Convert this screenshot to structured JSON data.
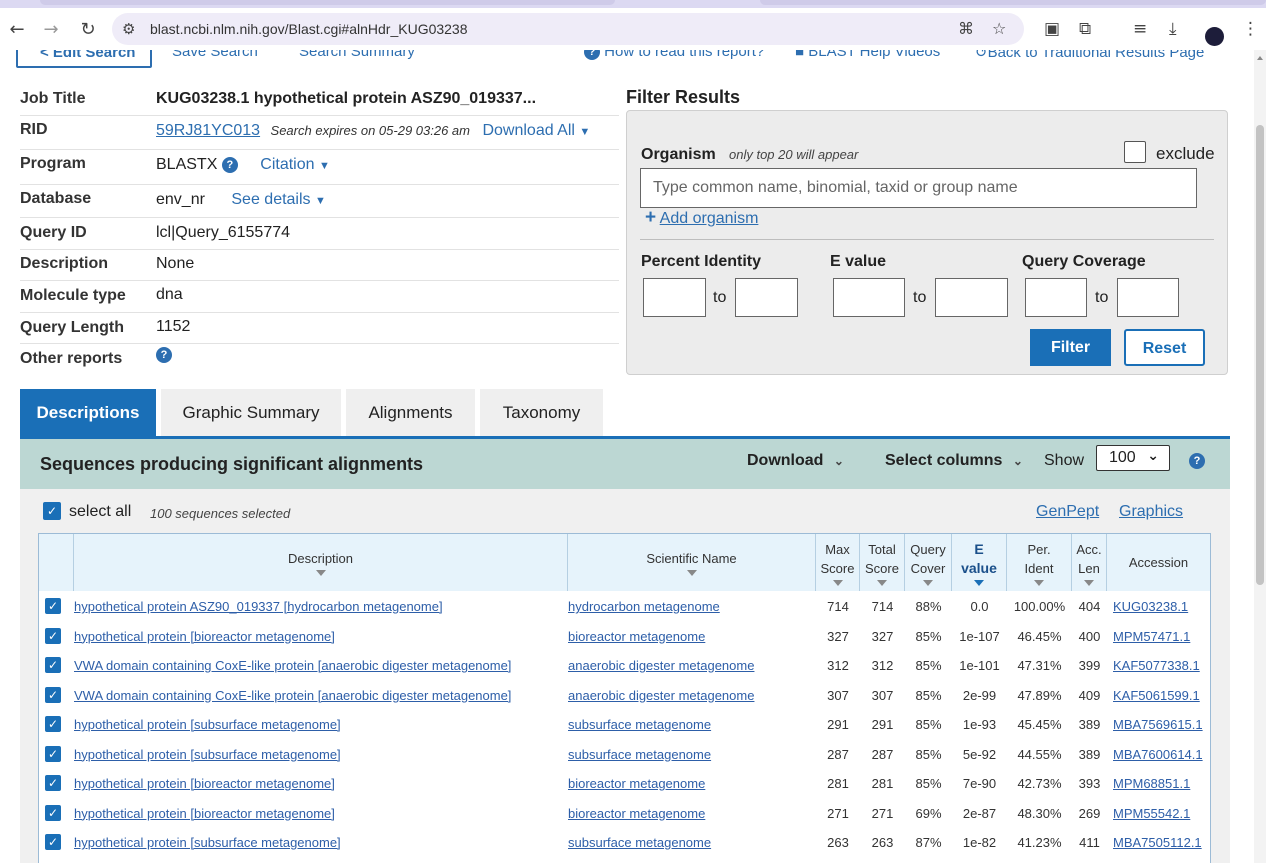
{
  "browser": {
    "url": "blast.ncbi.nlm.nih.gov/Blast.cgi#alnHdr_KUG03238",
    "icons": [
      "back-icon",
      "forward-icon",
      "reload-icon",
      "site-info-icon",
      "translate-icon",
      "bookmark-star-icon",
      "extension-icon",
      "puzzle-icon",
      "media-icon",
      "download-icon",
      "profile-avatar",
      "menu-icon"
    ]
  },
  "top_links": {
    "edit_search": "< Edit Search",
    "save_search": "Save Search",
    "search_summary": "Search Summary",
    "how_to_read": "How to read this report?",
    "help_videos": "BLAST Help Videos",
    "back_traditional": "Back to Traditional Results Page"
  },
  "job": {
    "rows": [
      {
        "label": "Job Title",
        "value": "KUG03238.1 hypothetical protein ASZ90_019337..."
      },
      {
        "label": "RID",
        "value": "59RJ81YC013",
        "note": "Search expires on 05-29 03:26 am",
        "action": "Download All"
      },
      {
        "label": "Program",
        "value": "BLASTX",
        "action": "Citation"
      },
      {
        "label": "Database",
        "value": "env_nr",
        "action": "See details"
      },
      {
        "label": "Query ID",
        "value": "lcl|Query_6155774"
      },
      {
        "label": "Description",
        "value": "None"
      },
      {
        "label": "Molecule type",
        "value": "dna"
      },
      {
        "label": "Query Length",
        "value": "1152"
      },
      {
        "label": "Other reports",
        "value": ""
      }
    ]
  },
  "filter": {
    "title": "Filter Results",
    "organism_label": "Organism",
    "organism_note": "only top 20 will appear",
    "exclude_label": "exclude",
    "organism_placeholder": "Type common  name, binomial, taxid or group  name",
    "add_organism": "Add organism",
    "percent_identity": "Percent Identity",
    "e_value": "E value",
    "query_coverage": "Query Coverage",
    "to": "to",
    "filter_button": "Filter",
    "reset_button": "Reset"
  },
  "tabs": [
    "Descriptions",
    "Graphic Summary",
    "Alignments",
    "Taxonomy"
  ],
  "results": {
    "title": "Sequences producing significant alignments",
    "download": "Download",
    "select_columns": "Select columns",
    "show_label": "Show",
    "show_value": "100",
    "select_all": "select all",
    "selected_count": "100 sequences selected",
    "genpept": "GenPept",
    "graphics": "Graphics"
  },
  "table": {
    "headers": {
      "description": "Description",
      "scientific_name": "Scientific Name",
      "max_score": [
        "Max",
        "Score"
      ],
      "total_score": [
        "Total",
        "Score"
      ],
      "query_cover": [
        "Query",
        "Cover"
      ],
      "e_value": [
        "E",
        "value"
      ],
      "per_ident": [
        "Per.",
        "Ident"
      ],
      "acc_len": [
        "Acc.",
        "Len"
      ],
      "accession": "Accession"
    },
    "rows": [
      {
        "description": "hypothetical protein ASZ90_019337 [hydrocarbon metagenome]",
        "scientific_name": "hydrocarbon metagenome",
        "max_score": "714",
        "total_score": "714",
        "query_cover": "88%",
        "e_value": "0.0",
        "per_ident": "100.00%",
        "acc_len": "404",
        "accession": "KUG03238.1"
      },
      {
        "description": "hypothetical protein [bioreactor metagenome]",
        "scientific_name": "bioreactor metagenome",
        "max_score": "327",
        "total_score": "327",
        "query_cover": "85%",
        "e_value": "1e-107",
        "per_ident": "46.45%",
        "acc_len": "400",
        "accession": "MPM57471.1"
      },
      {
        "description": "VWA domain containing CoxE-like protein [anaerobic digester metagenome]",
        "scientific_name": "anaerobic digester metagenome",
        "max_score": "312",
        "total_score": "312",
        "query_cover": "85%",
        "e_value": "1e-101",
        "per_ident": "47.31%",
        "acc_len": "399",
        "accession": "KAF5077338.1"
      },
      {
        "description": "VWA domain containing CoxE-like protein [anaerobic digester metagenome]",
        "scientific_name": "anaerobic digester metagenome",
        "max_score": "307",
        "total_score": "307",
        "query_cover": "85%",
        "e_value": "2e-99",
        "per_ident": "47.89%",
        "acc_len": "409",
        "accession": "KAF5061599.1"
      },
      {
        "description": "hypothetical protein [subsurface metagenome]",
        "scientific_name": "subsurface metagenome",
        "max_score": "291",
        "total_score": "291",
        "query_cover": "85%",
        "e_value": "1e-93",
        "per_ident": "45.45%",
        "acc_len": "389",
        "accession": "MBA7569615.1"
      },
      {
        "description": "hypothetical protein [subsurface metagenome]",
        "scientific_name": "subsurface metagenome",
        "max_score": "287",
        "total_score": "287",
        "query_cover": "85%",
        "e_value": "5e-92",
        "per_ident": "44.55%",
        "acc_len": "389",
        "accession": "MBA7600614.1"
      },
      {
        "description": "hypothetical protein [bioreactor metagenome]",
        "scientific_name": "bioreactor metagenome",
        "max_score": "281",
        "total_score": "281",
        "query_cover": "85%",
        "e_value": "7e-90",
        "per_ident": "42.73%",
        "acc_len": "393",
        "accession": "MPM68851.1"
      },
      {
        "description": "hypothetical protein [bioreactor metagenome]",
        "scientific_name": "bioreactor metagenome",
        "max_score": "271",
        "total_score": "271",
        "query_cover": "69%",
        "e_value": "2e-87",
        "per_ident": "48.30%",
        "acc_len": "269",
        "accession": "MPM55542.1"
      },
      {
        "description": "hypothetical protein [subsurface metagenome]",
        "scientific_name": "subsurface metagenome",
        "max_score": "263",
        "total_score": "263",
        "query_cover": "87%",
        "e_value": "1e-82",
        "per_ident": "41.23%",
        "acc_len": "411",
        "accession": "MBA7505112.1"
      }
    ]
  },
  "colors": {
    "accent": "#1a6fb7",
    "link": "#2d6eb0",
    "results_bar": "#bcd7d3"
  }
}
